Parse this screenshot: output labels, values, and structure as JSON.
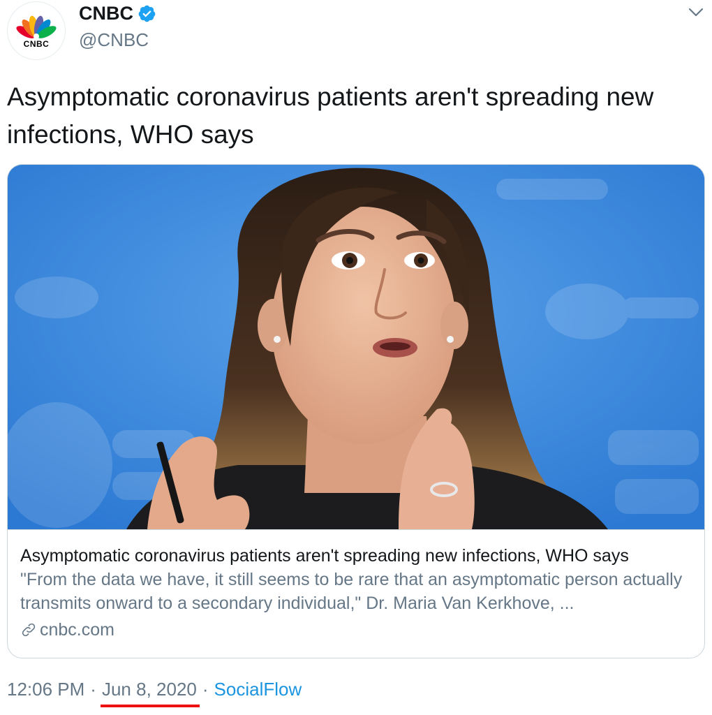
{
  "author": {
    "name": "CNBC",
    "handle": "@CNBC",
    "verified": true,
    "avatar_logo_text": "CNBC"
  },
  "tweet": {
    "text": "Asymptomatic coronavirus patients aren't spreading new infections, WHO says"
  },
  "card": {
    "image_icon": "news-photo-image",
    "title": "Asymptomatic coronavirus patients aren't spreading new infections, WHO says",
    "description": "\"From the data we have, it still seems to be rare that an asymptomatic person actually transmits onward to a secondary individual,\" Dr. Maria Van Kerkhove, ...",
    "domain": "cnbc.com",
    "domain_icon": "link-icon"
  },
  "footer": {
    "time": "12:06 PM",
    "separator": "·",
    "date": "Jun 8, 2020",
    "source": "SocialFlow"
  },
  "colors": {
    "text_primary": "#14171a",
    "text_secondary": "#657786",
    "link": "#1b95e0",
    "verified": "#1da1f2",
    "border": "#ccd6dd",
    "date_underline": "#ee1111",
    "image_background": "#2f7fd8"
  },
  "icons": {
    "menu": "chevron-down-icon",
    "verified": "verified-badge-icon"
  }
}
